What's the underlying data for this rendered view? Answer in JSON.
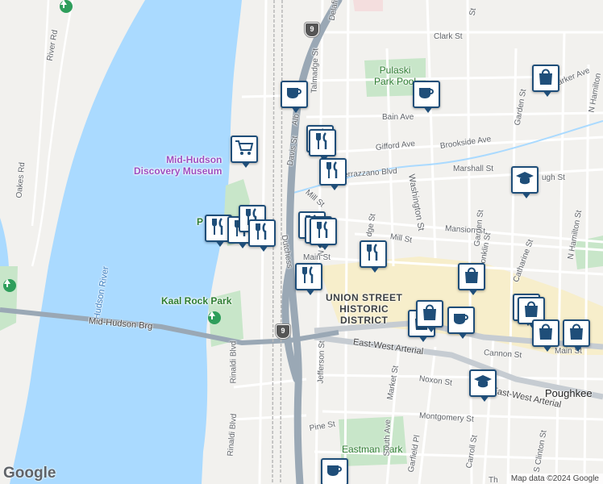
{
  "map": {
    "attribution": "Map data ©2024 Google",
    "google_logo": "Google",
    "colors": {
      "water": "#aadaff",
      "land": "#f2f1ee",
      "park": "#c8e6c9",
      "highway": "#9aa8b5",
      "road": "#ffffff",
      "district": "#f7eecb",
      "marker": "#1f4e79"
    }
  },
  "water_label": "Hudson River",
  "pois": {
    "museum": "Mid-Hudson\nDiscovery Museum",
    "kaal_rock": "Kaal Rock Park",
    "pulaski": "Pulaski\nPark Pool",
    "eastman": "Eastman Park",
    "p_partial": "P"
  },
  "district": "UNION STREET\nHISTORIC\nDISTRICT",
  "city": "Poughkee",
  "route_shields": [
    "9",
    "9"
  ],
  "streets": {
    "river_rd": "River Rd",
    "oakes_rd": "Oakes Rd",
    "mid_hudson_brg": "Mid-Hudson Brg",
    "rinaldi_1": "Rinaldi Blvd",
    "rinaldi_2": "Rinaldi Blvd",
    "clark": "Clark St",
    "delafield": "Delafield",
    "bain": "Bain Ave",
    "talmadge": "Talmadge St",
    "gifford": "Gifford Ave",
    "brookside": "Brookside Ave",
    "verrazzano": "Verrazzano Blvd",
    "marshall": "Marshall St",
    "washington": "Washington St",
    "mansion": "Mansion St",
    "mill": "Mill St",
    "mill2": "Mill St",
    "n_perry": "N Perry St",
    "main": "Main St",
    "main2": "Main St",
    "ew_arterial": "East-West Arterial",
    "ew_arterial2": "East-West Arterial",
    "cannon": "Cannon St",
    "noxon": "Noxon St",
    "jefferson": "Jefferson St",
    "market": "Market St",
    "montgomery": "Montgomery St",
    "pine": "Pine St",
    "south_ave": "South Ave",
    "garfield": "Garfield Pl",
    "carroll": "Carroll St",
    "s_clinton": "S Clinton St",
    "conklin": "Conklin St",
    "catharine": "Catharine St",
    "garden": "Garden St",
    "garden2": "Garden St",
    "n_hamilton": "N Hamilton St",
    "n_hamilton2": "N Hamilton",
    "parker": "Parker Ave",
    "davis": "Davis St",
    "dutchess": "Dutchess",
    "albert": "Alb",
    "ridge": "dge St",
    "augh": "ugh St",
    "st_frag": "St",
    "th_frag": "Th"
  },
  "markers": [
    {
      "type": "coffee"
    },
    {
      "type": "coffee"
    },
    {
      "type": "coffee"
    },
    {
      "type": "coffee"
    },
    {
      "type": "shopping-cart"
    },
    {
      "type": "restaurant"
    },
    {
      "type": "restaurant"
    },
    {
      "type": "restaurant"
    },
    {
      "type": "restaurant"
    },
    {
      "type": "restaurant"
    },
    {
      "type": "restaurant"
    },
    {
      "type": "restaurant"
    },
    {
      "type": "restaurant"
    },
    {
      "type": "restaurant"
    },
    {
      "type": "restaurant"
    },
    {
      "type": "restaurant"
    },
    {
      "type": "restaurant"
    },
    {
      "type": "shopping-bag"
    },
    {
      "type": "shopping-bag"
    },
    {
      "type": "shopping-bag"
    },
    {
      "type": "shopping-bag"
    },
    {
      "type": "shopping-bag"
    },
    {
      "type": "shopping-bag"
    },
    {
      "type": "shopping-bag"
    },
    {
      "type": "shopping-bag"
    },
    {
      "type": "school"
    },
    {
      "type": "school"
    }
  ]
}
